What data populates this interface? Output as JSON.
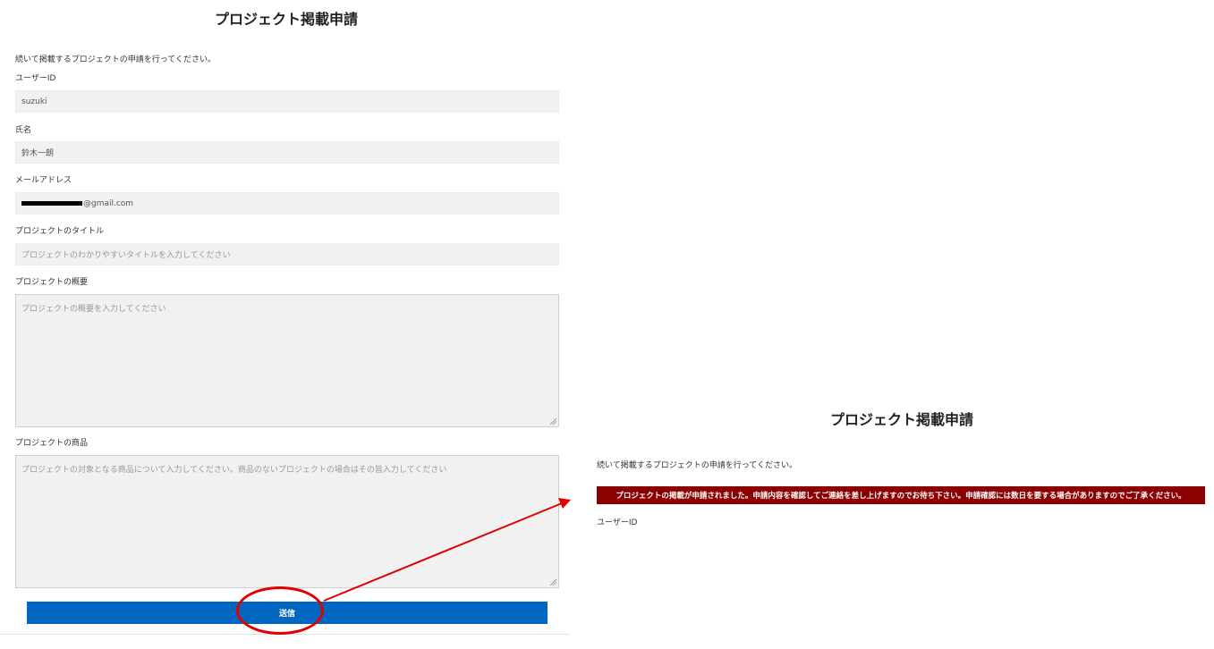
{
  "left_form": {
    "title": "プロジェクト掲載申請",
    "intro": "続いて掲載するプロジェクトの申請を行ってください。",
    "user_id": {
      "label": "ユーザーID",
      "value": "suzuki"
    },
    "full_name": {
      "label": "氏名",
      "value": "鈴木一朗"
    },
    "email": {
      "label": "メールアドレス",
      "value": "@gmail.com"
    },
    "project_title": {
      "label": "プロジェクトのタイトル",
      "placeholder": "プロジェクトのわかりやすいタイトルを入力してください"
    },
    "project_summary": {
      "label": "プロジェクトの概要",
      "placeholder": "プロジェクトの概要を入力してください"
    },
    "project_product": {
      "label": "プロジェクトの商品",
      "placeholder": "プロジェクトの対象となる商品について入力してください。商品のないプロジェクトの場合はその旨入力してください"
    },
    "submit_label": "送信"
  },
  "right_form": {
    "title": "プロジェクト掲載申請",
    "intro": "続いて掲載するプロジェクトの申請を行ってください。",
    "success_message": "プロジェクトの掲載が申請されました。申請内容を確認してご連絡を差し上げますのでお待ち下さい。申請確認には数日を要する場合がありますのでご了承ください。",
    "user_id_label": "ユーザーID"
  },
  "colors": {
    "submit_button": "#0066bf",
    "success_banner": "#8b0000",
    "annotation": "#e00000",
    "field_background": "#f1f1f1"
  }
}
